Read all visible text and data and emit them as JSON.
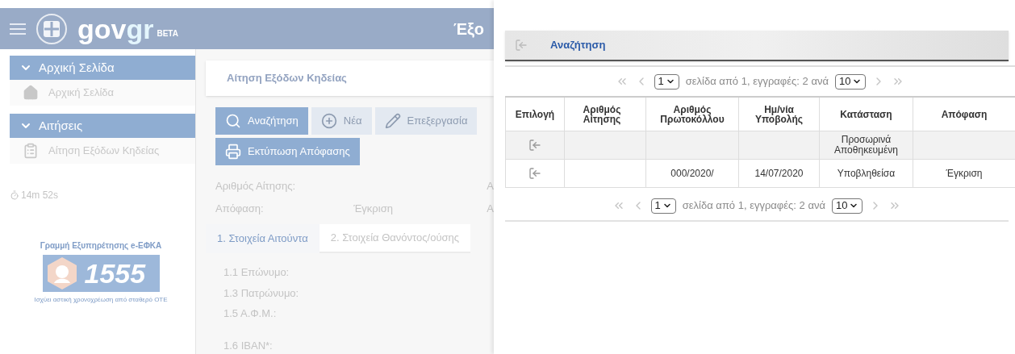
{
  "background_app": {
    "header": {
      "logo_gov": "gov",
      "logo_gr": "gr",
      "logo_badge": "BETA",
      "title": "Έξο"
    },
    "sidebar": {
      "sections": [
        {
          "label": "Αρχική Σελίδα",
          "expanded": true,
          "items": [
            {
              "label": "Αρχική Σελίδα",
              "kind": "home"
            }
          ]
        },
        {
          "label": "Αιτήσεις",
          "expanded": true,
          "items": [
            {
              "label": "Αίτηση Εξόδων Κηδείας",
              "kind": "clipboard"
            }
          ]
        }
      ],
      "timer": "14m 52s",
      "helpline": {
        "title": "Γραμμή Εξυπηρέτησης e-ΕΦΚΑ",
        "number": "1555",
        "note": "Ισχύει αστική χρονοχρέωση από σταθερό ΟΤΕ"
      }
    },
    "page_title": "Αίτηση Εξόδων Κηδείας",
    "toolbar": [
      {
        "label": "Αναζήτηση",
        "kind": "search",
        "selected": true
      },
      {
        "label": "Νέα",
        "kind": "new",
        "selected": false
      },
      {
        "label": "Επεξεργασία",
        "kind": "edit",
        "selected": false
      },
      {
        "label": "Εκτύπωση Απόφασης",
        "kind": "print",
        "selected": true
      }
    ],
    "summary": [
      {
        "label": "Αριθμός Αίτησης:",
        "column_3": "Α"
      },
      {
        "label": "Απόφαση:",
        "value": "Έγκριση",
        "column_3": "Α"
      }
    ],
    "tabs": [
      {
        "label": "1. Στοιχεία Αιτούντα",
        "selected": true
      },
      {
        "label": "2. Στοιχεία Θανόντος/ούσης",
        "selected": false
      }
    ],
    "form_fields": [
      {
        "label": "1.1 Επώνυμο:"
      },
      {
        "label": "1.3 Πατρώνυμο:"
      },
      {
        "label": "1.5 Α.Φ.Μ.:"
      },
      {
        "label": "1.6 IBAN*:"
      }
    ]
  },
  "dialog": {
    "title": "Αναζήτηση",
    "pager_top": {
      "page": "1",
      "text": "σελίδα από 1, εγγραφές: 2 ανά",
      "page_size": "10"
    },
    "table": {
      "columns": [
        "Επιλογή",
        "Αριθμός Αίτησης",
        "Αριθμός Πρωτοκόλλου",
        "Ημ/νία Υποβολής",
        "Κατάσταση",
        "Απόφαση"
      ],
      "rows": [
        {
          "selected": true,
          "status": "Προσωρινά Αποθηκευμένη"
        },
        {
          "selected": false,
          "protocol_number": "000/2020/",
          "submission_date": "14/07/2020",
          "status": "Υποβληθείσα",
          "decision": "Έγκριση"
        }
      ]
    },
    "pager_bottom": {
      "page": "1",
      "text": "σελίδα από 1, εγγραφές: 2 ανά",
      "page_size": "10"
    }
  }
}
